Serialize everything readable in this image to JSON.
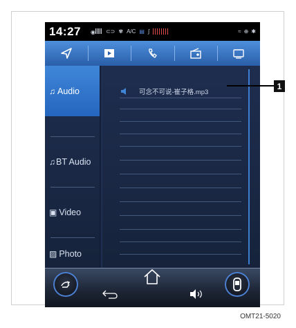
{
  "status_bar": {
    "time": "14:27",
    "ac_label": "A/C"
  },
  "tabs": [
    {
      "icon": "navigation-arrow-icon"
    },
    {
      "icon": "media-play-icon",
      "selected": true
    },
    {
      "icon": "phone-icon"
    },
    {
      "icon": "radio-icon"
    },
    {
      "icon": "vehicle-display-icon"
    }
  ],
  "sidebar": {
    "items": [
      {
        "label": "Audio",
        "icon": "music-note-icon",
        "active": true
      },
      {
        "label": "BT Audio",
        "icon": "bluetooth-music-icon"
      },
      {
        "label": "Video",
        "icon": "video-icon"
      },
      {
        "label": "Photo",
        "icon": "photo-icon"
      }
    ]
  },
  "playlist": {
    "now_playing": "可念不可说-崔子格.mp3"
  },
  "callout": {
    "number": "1"
  },
  "figure_code": "OMT21-5020",
  "colors": {
    "accent": "#3f86d8",
    "screen_bg": "#1a2845",
    "tab_bar": "#4d8fdc",
    "statusbar_bg": "#000000"
  }
}
